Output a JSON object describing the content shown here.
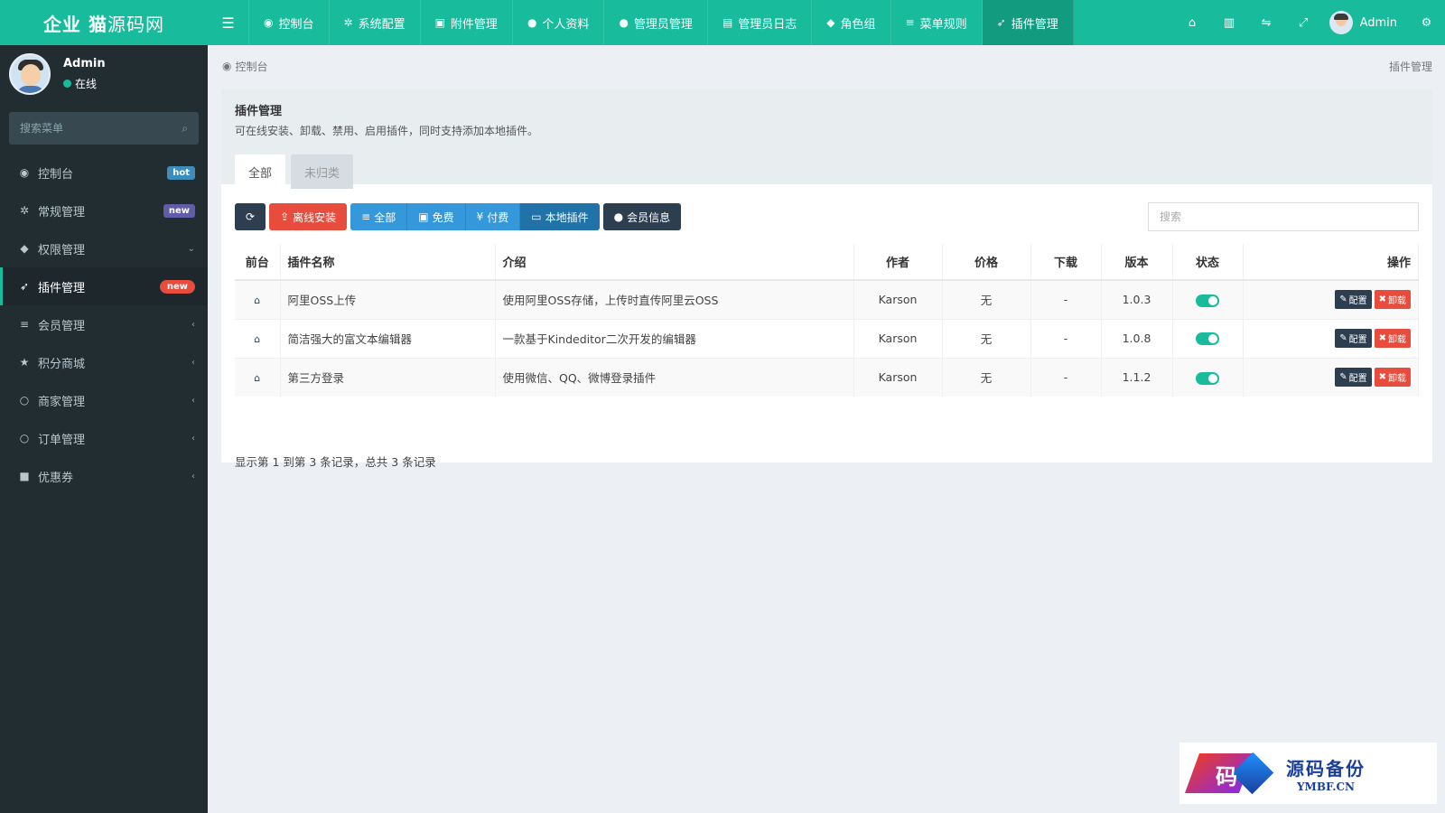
{
  "brand": {
    "bold": "企业 猫",
    "light": "源码网"
  },
  "topnav": [
    {
      "icon": "dashboard-icon",
      "glyph": "◉",
      "label": "控制台"
    },
    {
      "icon": "gear-icon",
      "glyph": "✲",
      "label": "系统配置"
    },
    {
      "icon": "image-icon",
      "glyph": "▣",
      "label": "附件管理"
    },
    {
      "icon": "user-icon",
      "glyph": "●",
      "label": "个人资料"
    },
    {
      "icon": "user-icon",
      "glyph": "●",
      "label": "管理员管理"
    },
    {
      "icon": "list-alt-icon",
      "glyph": "▤",
      "label": "管理员日志"
    },
    {
      "icon": "group-icon",
      "glyph": "◆",
      "label": "角色组"
    },
    {
      "icon": "bars-icon",
      "glyph": "≡",
      "label": "菜单规则"
    },
    {
      "icon": "rocket-icon",
      "glyph": "➶",
      "label": "插件管理"
    }
  ],
  "topright": {
    "user": "Admin"
  },
  "user": {
    "name": "Admin",
    "status": "在线"
  },
  "sidebar_search": {
    "placeholder": "搜索菜单"
  },
  "menu": [
    {
      "glyph": "◉",
      "label": "控制台",
      "badge": "hot"
    },
    {
      "glyph": "✲",
      "label": "常规管理",
      "badge": "new"
    },
    {
      "glyph": "◆",
      "label": "权限管理",
      "chev": "⌄"
    },
    {
      "glyph": "➶",
      "label": "插件管理",
      "badge": "new"
    },
    {
      "glyph": "≡",
      "label": "会员管理",
      "chev": "‹"
    },
    {
      "glyph": "★",
      "label": "积分商城",
      "chev": "‹"
    },
    {
      "glyph": "○",
      "label": "商家管理",
      "chev": "‹"
    },
    {
      "glyph": "○",
      "label": "订单管理",
      "chev": "‹"
    },
    {
      "glyph": "■",
      "label": "优惠券",
      "chev": "‹"
    }
  ],
  "breadcrumb": {
    "home": "控制台",
    "current": "插件管理"
  },
  "panel": {
    "title": "插件管理",
    "desc": "可在线安装、卸载、禁用、启用插件，同时支持添加本地插件。",
    "tabs": [
      "全部",
      "未归类"
    ]
  },
  "toolbar": {
    "offline_install": "离线安装",
    "filter_all": "全部",
    "filter_free": "免费",
    "filter_paid": "付费",
    "local": "本地插件",
    "member": "会员信息",
    "search_placeholder": "搜索"
  },
  "table": {
    "headers": [
      "前台",
      "插件名称",
      "介绍",
      "作者",
      "价格",
      "下载",
      "版本",
      "状态",
      "操作"
    ],
    "rows": [
      {
        "name": "阿里OSS上传",
        "intro": "使用阿里OSS存储，上传时直传阿里云OSS",
        "author": "Karson",
        "price": "无",
        "downloads": "-",
        "version": "1.0.3",
        "enabled": true
      },
      {
        "name": "简洁强大的富文本编辑器",
        "intro": "一款基于Kindeditor二次开发的编辑器",
        "author": "Karson",
        "price": "无",
        "downloads": "-",
        "version": "1.0.8",
        "enabled": true
      },
      {
        "name": "第三方登录",
        "intro": "使用微信、QQ、微博登录插件",
        "author": "Karson",
        "price": "无",
        "downloads": "-",
        "version": "1.1.2",
        "enabled": true
      }
    ],
    "action_config": "配置",
    "action_uninstall": "卸载"
  },
  "pagination": {
    "summary": "显示第 1 到第 3 条记录，总共 3 条记录"
  },
  "watermark": {
    "cn": "源码备份",
    "en": "YMBF.CN",
    "glyph": "码"
  },
  "colors": {
    "primary": "#18bc9c",
    "sidebar": "#222d32",
    "danger": "#e74c3c",
    "info": "#3498db",
    "dark": "#2c3e50"
  }
}
